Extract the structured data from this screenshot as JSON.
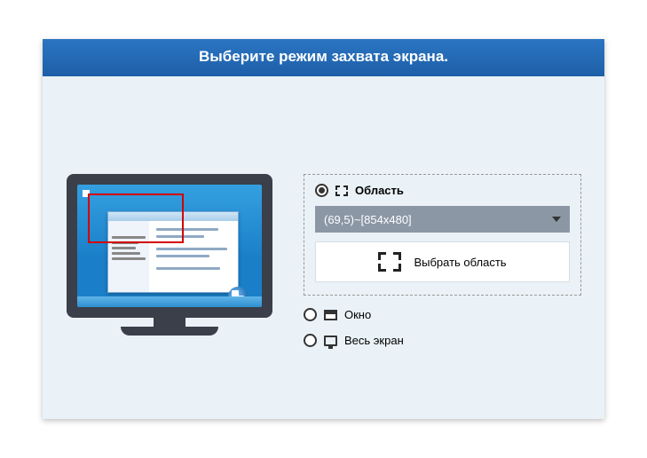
{
  "title": "Выберите режим захвата экрана.",
  "options": {
    "region": {
      "label": "Область",
      "selected": true
    },
    "window": {
      "label": "Окно",
      "selected": false
    },
    "fullscreen": {
      "label": "Весь экран",
      "selected": false
    }
  },
  "region": {
    "dropdown_value": "(69,5)~[854x480]",
    "select_button": "Выбрать область"
  }
}
